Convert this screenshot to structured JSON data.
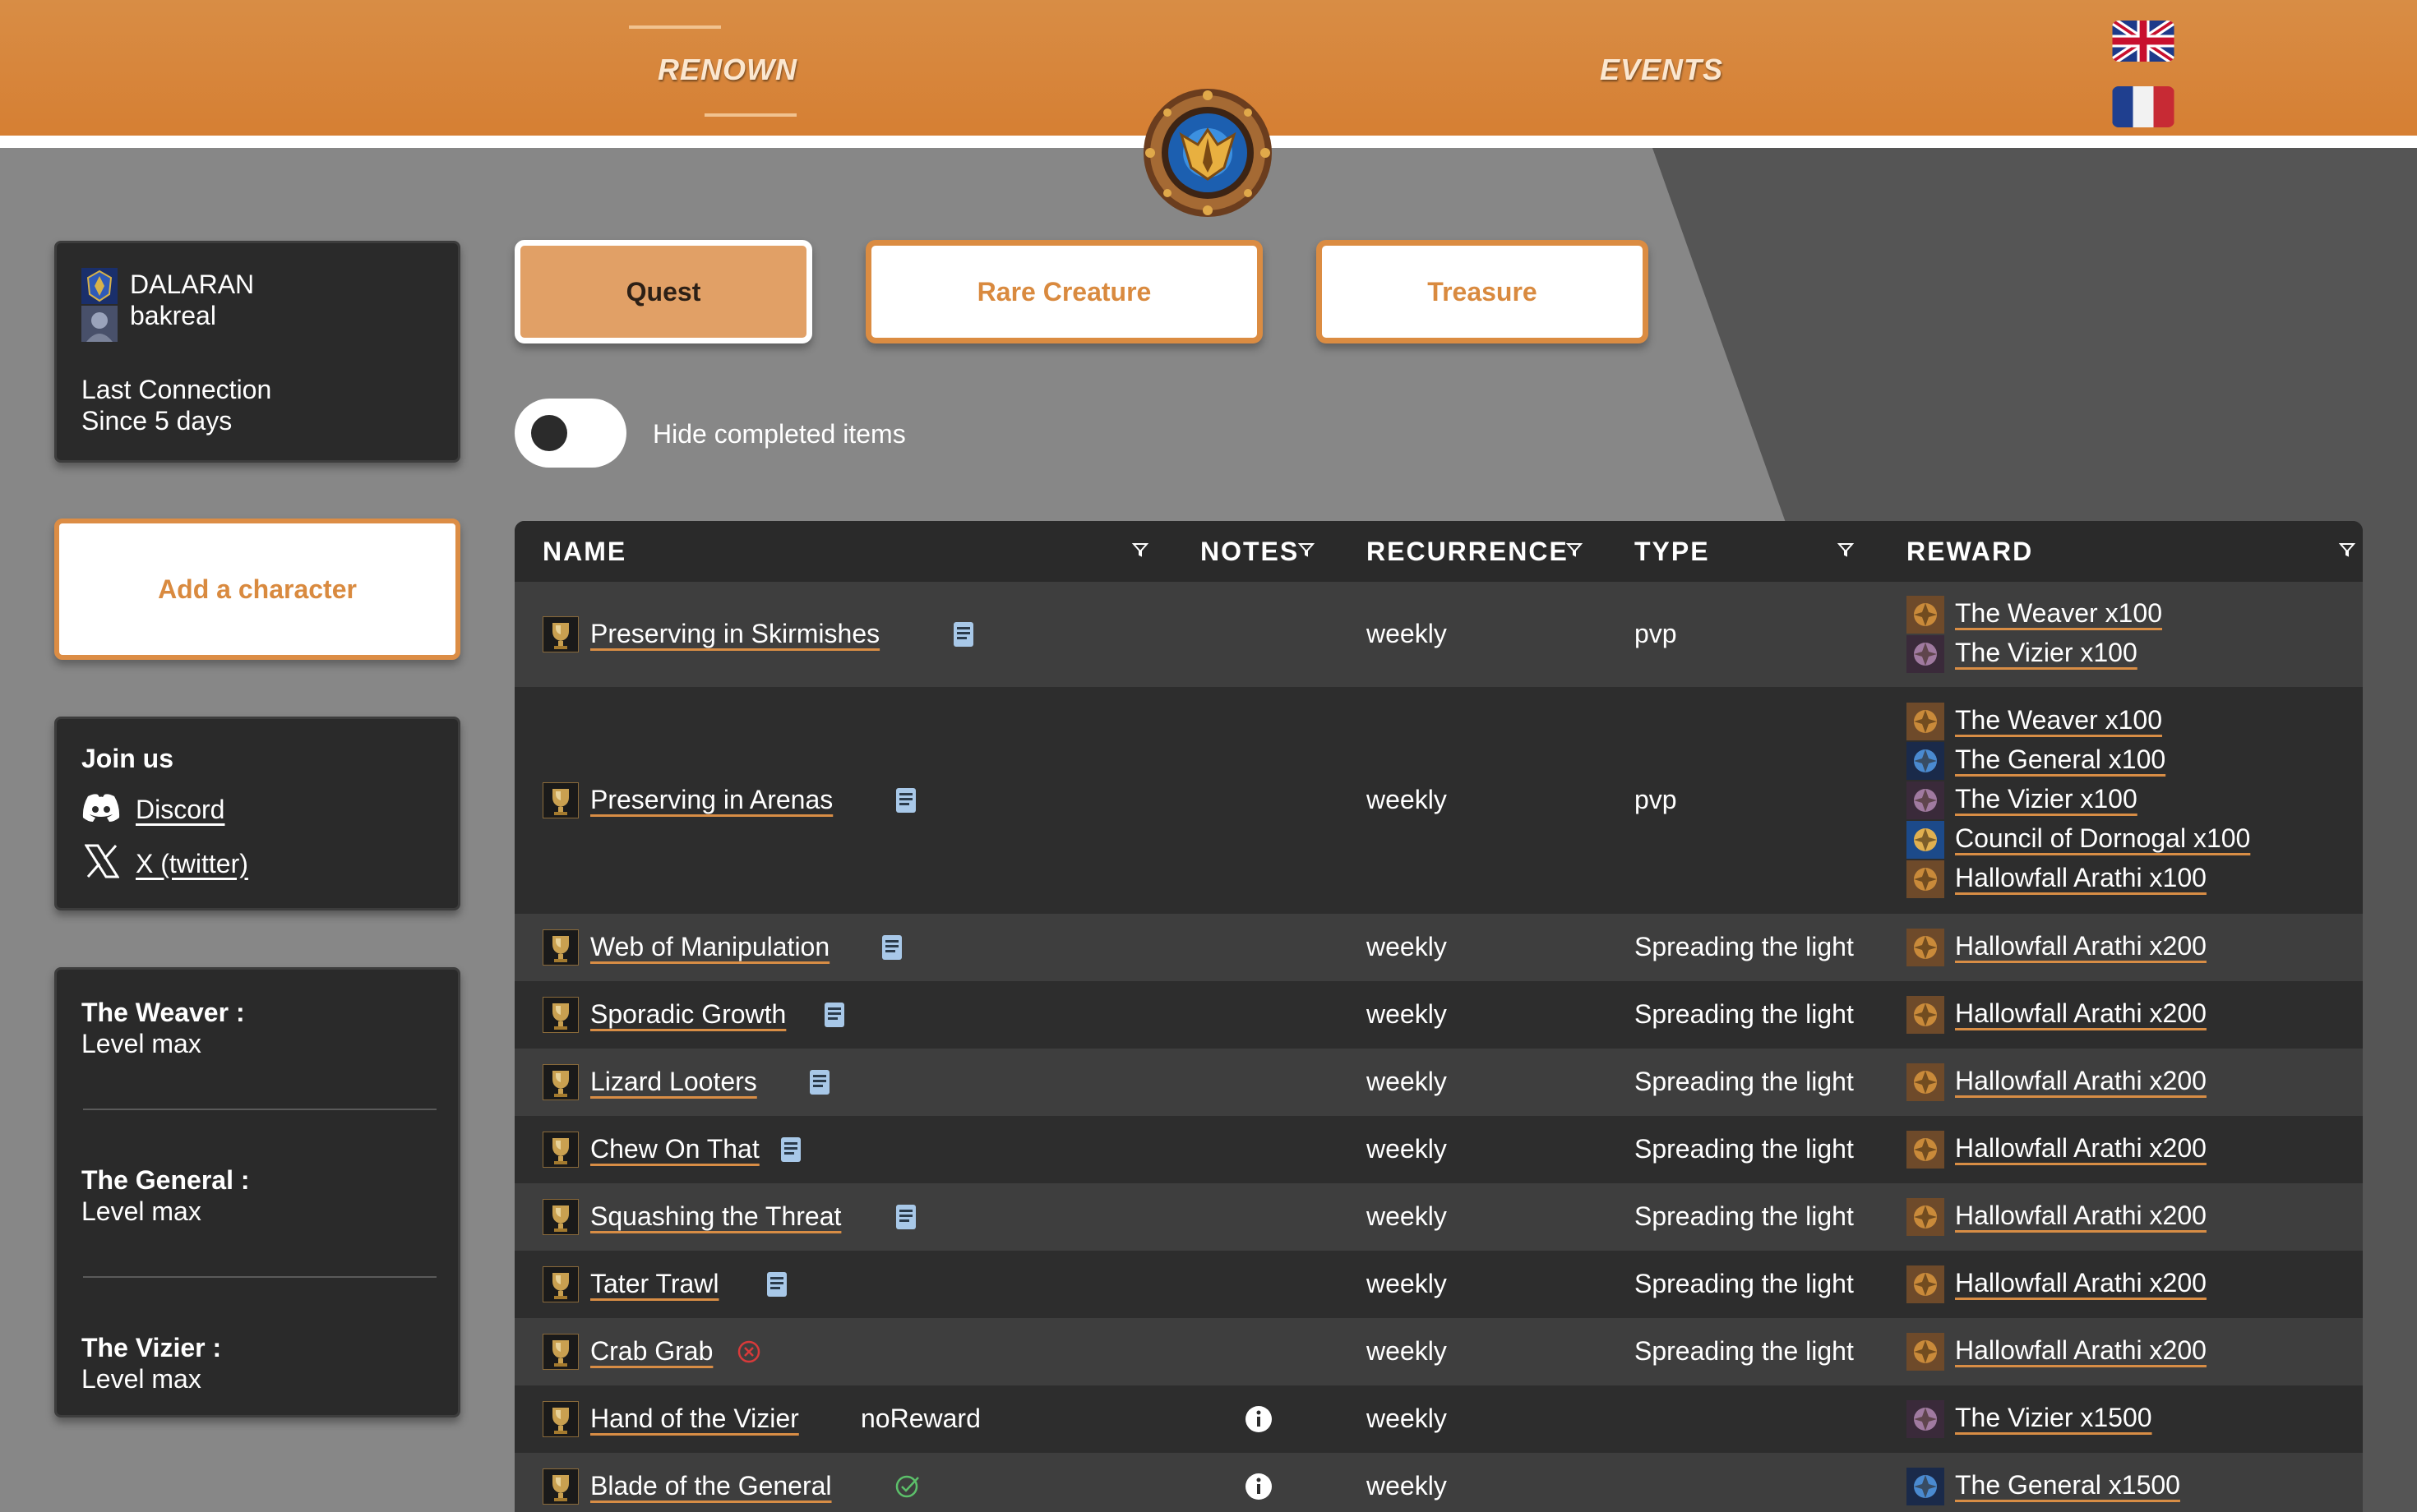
{
  "header": {
    "nav": [
      {
        "label": "RENOWN"
      },
      {
        "label": "EVENTS"
      }
    ],
    "flags": [
      "uk-flag",
      "france-flag"
    ]
  },
  "character": {
    "realm": "DALARAN",
    "name": "bakreal",
    "last_connection_label": "Last Connection",
    "last_connection_value": "Since 5 days"
  },
  "add_character": "Add a character",
  "join": {
    "title": "Join us",
    "discord": "Discord",
    "twitter": "X (twitter)"
  },
  "renown_levels": [
    {
      "faction": "The Weaver :",
      "level": "Level max"
    },
    {
      "faction": "The General :",
      "level": "Level max"
    },
    {
      "faction": "The Vizier :",
      "level": "Level max"
    }
  ],
  "tabs": [
    {
      "label": "Quest",
      "active": true
    },
    {
      "label": "Rare Creature",
      "active": false
    },
    {
      "label": "Treasure",
      "active": false
    }
  ],
  "toggle": {
    "label": "Hide completed items",
    "on": false
  },
  "table": {
    "headers": {
      "name": "NAME",
      "notes": "NOTES",
      "recurrence": "RECURRENCE",
      "type": "TYPE",
      "reward": "REWARD"
    },
    "rows": [
      {
        "name": "Preserving in Skirmishes",
        "note": "book",
        "extra": "",
        "recurrence": "weekly",
        "type": "pvp",
        "rewards": [
          "The Weaver x100",
          "The Vizier x100"
        ]
      },
      {
        "name": "Preserving in Arenas",
        "note": "book",
        "extra": "",
        "recurrence": "weekly",
        "type": "pvp",
        "rewards": [
          "The Weaver x100",
          "The General x100",
          "The Vizier x100",
          "Council of Dornogal x100",
          "Hallowfall Arathi x100"
        ]
      },
      {
        "name": "Web of Manipulation",
        "note": "book",
        "extra": "",
        "recurrence": "weekly",
        "type": "Spreading the light",
        "rewards": [
          "Hallowfall Arathi x200"
        ]
      },
      {
        "name": "Sporadic Growth",
        "note": "book",
        "extra": "",
        "recurrence": "weekly",
        "type": "Spreading the light",
        "rewards": [
          "Hallowfall Arathi x200"
        ]
      },
      {
        "name": "Lizard Looters",
        "note": "book",
        "extra": "",
        "recurrence": "weekly",
        "type": "Spreading the light",
        "rewards": [
          "Hallowfall Arathi x200"
        ]
      },
      {
        "name": "Chew On That",
        "note": "book",
        "extra": "",
        "recurrence": "weekly",
        "type": "Spreading the light",
        "rewards": [
          "Hallowfall Arathi x200"
        ]
      },
      {
        "name": "Squashing the Threat",
        "note": "book",
        "extra": "",
        "recurrence": "weekly",
        "type": "Spreading the light",
        "rewards": [
          "Hallowfall Arathi x200"
        ]
      },
      {
        "name": "Tater Trawl",
        "note": "book",
        "extra": "",
        "recurrence": "weekly",
        "type": "Spreading the light",
        "rewards": [
          "Hallowfall Arathi x200"
        ]
      },
      {
        "name": "Crab Grab",
        "note": "cross",
        "extra": "",
        "recurrence": "weekly",
        "type": "Spreading the light",
        "rewards": [
          "Hallowfall Arathi x200"
        ]
      },
      {
        "name": "Hand of the Vizier",
        "note": "",
        "extra": "noReward",
        "recurrence": "weekly",
        "type": "",
        "rewards": [
          "The Vizier x1500"
        ],
        "info": true
      },
      {
        "name": "Blade of the General",
        "note": "check",
        "extra": "",
        "recurrence": "weekly",
        "type": "",
        "rewards": [
          "The General x1500"
        ],
        "info": true
      }
    ]
  },
  "colors": {
    "accent": "#d88d45",
    "background": "#878787",
    "dark_panel": "#2a2a2a"
  }
}
